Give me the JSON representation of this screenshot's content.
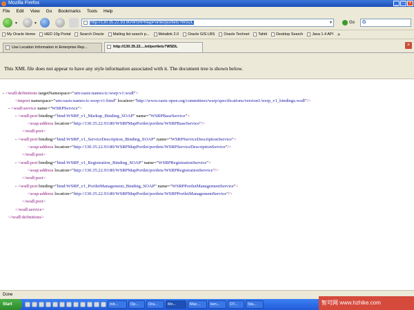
{
  "window": {
    "title": "Mozilla Firefox"
  },
  "menu": [
    "File",
    "Edit",
    "View",
    "Go",
    "Bookmarks",
    "Tools",
    "Help"
  ],
  "navigation": {
    "url": "http://130.35.22.93:80/WSRPMapPortlet/portlets?WSDL",
    "go_label": "Go",
    "search_glyph": "G"
  },
  "bookmarks": [
    "My Oracle Home",
    "HED 10g Portal",
    "Search Oracle",
    "Mailing list search p...",
    "Metalink 2.0",
    "Oracle GIS LBS",
    "Oracle Technet",
    "Tahiti",
    "Desktop Search",
    "Java 1.4 API"
  ],
  "tabs": [
    {
      "label": "Use Location Information in Enterprise Rep...",
      "active": false
    },
    {
      "label": "http://130.35.22....let/portlets?WSDL",
      "active": true
    }
  ],
  "infobar": {
    "message": "This XML file does not appear to have any style information associated with it. The document tree is shown below."
  },
  "xml": {
    "definitions_open": "<wsdl:definitions",
    "definitions_attr": "targetNamespace",
    "definitions_val": "urn:oasis:names:tc:wsrp:v1:wsdl",
    "import_tag": "<import",
    "import_ns_attr": "namespace",
    "import_ns_val": "urn:oasis:names:tc:wsrp:v1:bind",
    "import_loc_attr": "location",
    "import_loc_val": "http://www.oasis-open.org/committees/wsrp/specifications/version1/wsrp_v1_bindings.wsdl",
    "service_open": "<wsdl:service",
    "name_attr": "name",
    "service_val": "WSRPService",
    "port_tag": "<wsdl:port",
    "binding_attr": "binding",
    "soap_tag": "<soap:address",
    "location_attr": "location",
    "port_close": "</wsdl:port>",
    "service_close": "</wsdl:service>",
    "definitions_close": "</wsdl:definitions>",
    "ports": [
      {
        "binding": "bind:WSRP_v1_Markup_Binding_SOAP",
        "name": "WSRPBaseService",
        "location": "http://130.35.22.93:80/WSRPMapPortlet/portlets/WSRPBaseService"
      },
      {
        "binding": "bind:WSRP_v1_ServiceDescription_Binding_SOAP",
        "name": "WSRPServiceDescriptionService",
        "location": "http://130.35.22.93:80/WSRPMapPortlet/portlets/WSRPServiceDescriptionService"
      },
      {
        "binding": "bind:WSRP_v1_Registration_Binding_SOAP",
        "name": "WSRPRegistrationService",
        "location": "http://130.35.22.93:80/WSRPMapPortlet/portlets/WSRPRegistrationService"
      },
      {
        "binding": "bind:WSRP_v1_PortletManagement_Binding_SOAP",
        "name": "WSRPPortletManagementService",
        "location": "http://130.35.22.93:80/WSRPMapPortlet/portlets/WSRPPortletManagementService"
      }
    ]
  },
  "status": {
    "text": "Done"
  },
  "taskbar": {
    "start_label": "Start",
    "buttons": [
      "Inb...",
      "Op...",
      "Ora...",
      "Mo...",
      "Mac...",
      "ken...",
      "OT...",
      "Sta..."
    ]
  },
  "watermark": {
    "text": "智可网 www.hzhike.com"
  }
}
